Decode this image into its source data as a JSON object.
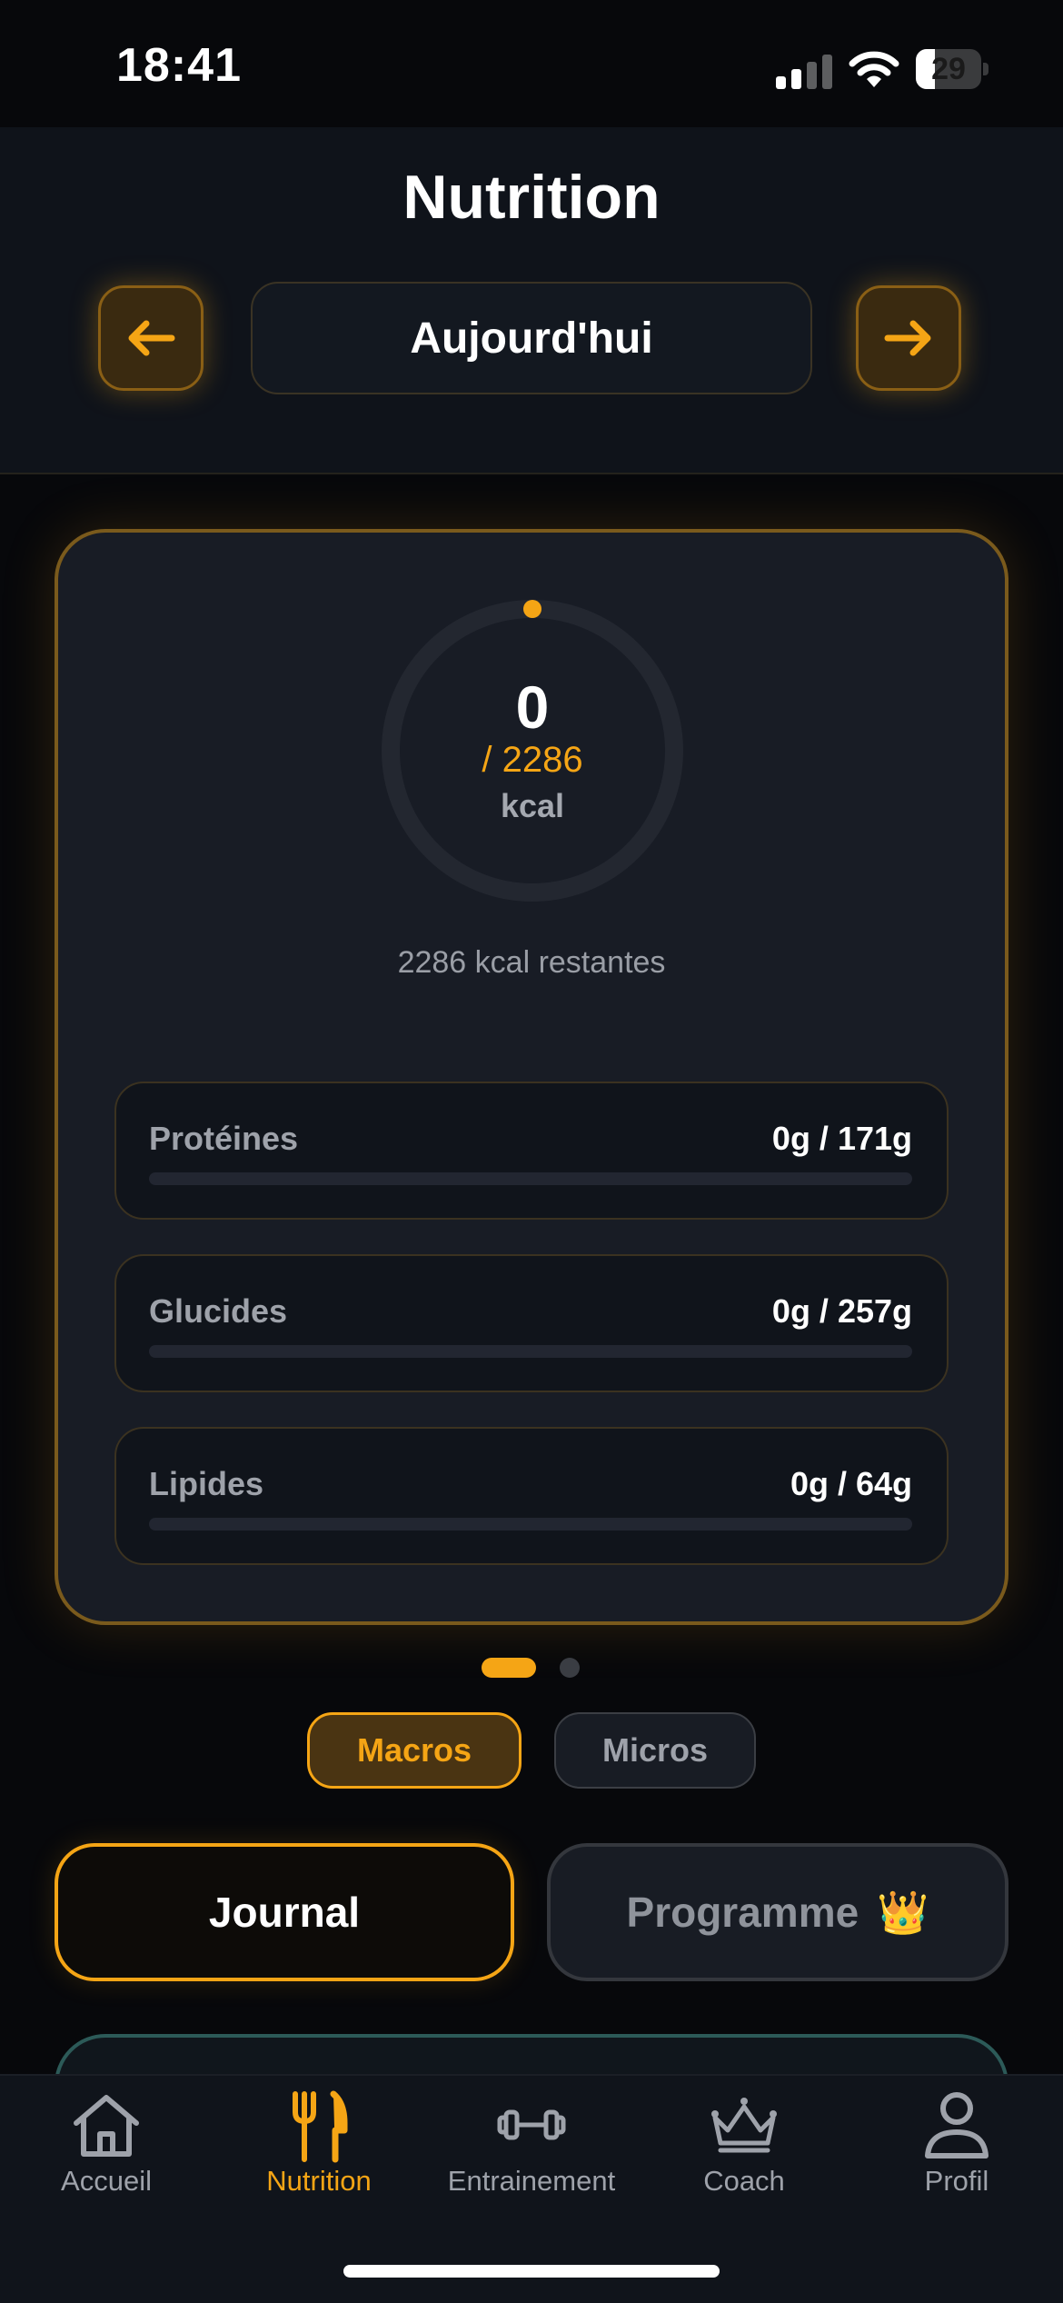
{
  "status_bar": {
    "time": "18:41",
    "battery": "29",
    "battery_level": 0.29
  },
  "header": {
    "title": "Nutrition",
    "date_label": "Aujourd'hui",
    "prev_icon": "arrow-left-icon",
    "next_icon": "arrow-right-icon"
  },
  "summary": {
    "eaten": "0",
    "goal": "/ 2286",
    "unit": "kcal",
    "remaining": "2286 kcal restantes",
    "progress": 0
  },
  "macros": [
    {
      "name": "Protéines",
      "value": "0g / 171g",
      "progress": 0
    },
    {
      "name": "Glucides",
      "value": "0g / 257g",
      "progress": 0
    },
    {
      "name": "Lipides",
      "value": "0g / 64g",
      "progress": 0
    }
  ],
  "pager": {
    "pages": 2,
    "active": 1
  },
  "toggle": {
    "macros": "Macros",
    "micros": "Micros",
    "active": "macros"
  },
  "tabs": {
    "journal": "Journal",
    "programme": "Programme",
    "programme_badge": "👑"
  },
  "nav": [
    {
      "label": "Accueil",
      "icon": "home-icon"
    },
    {
      "label": "Nutrition",
      "icon": "fork-knife-icon",
      "active": true
    },
    {
      "label": "Entrainement",
      "icon": "dumbbell-icon"
    },
    {
      "label": "Coach",
      "icon": "crown-icon"
    },
    {
      "label": "Profil",
      "icon": "user-icon"
    }
  ],
  "colors": {
    "accent": "#f5a515",
    "background": "#07080b",
    "card": "#181c25",
    "muted": "#9ea2aa"
  }
}
